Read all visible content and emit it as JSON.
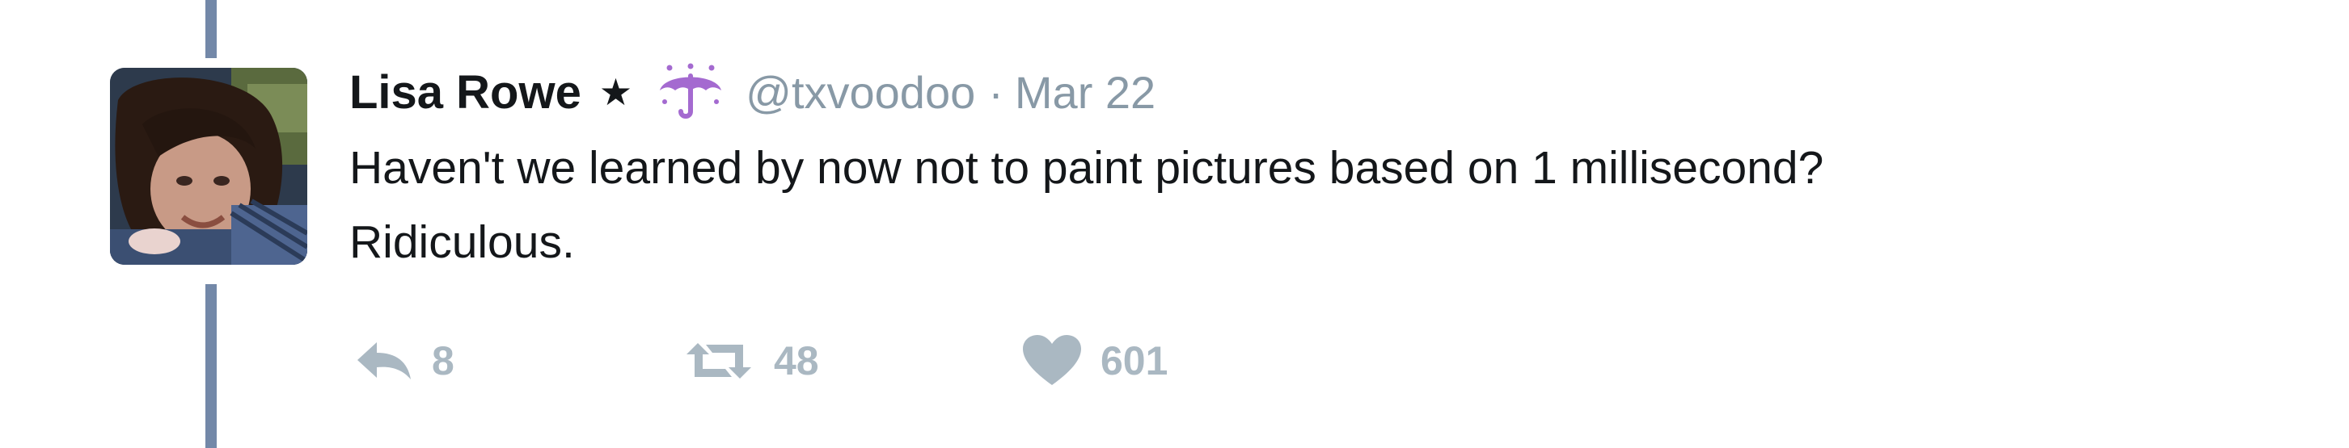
{
  "tweet": {
    "author": {
      "name": "Lisa Rowe",
      "handle": "@txvoodoo"
    },
    "separator": "·",
    "date": "Mar 22",
    "text_lines": [
      "Haven't we learned by now not to paint pictures based on 1 millisecond?",
      "Ridiculous."
    ],
    "icons": {
      "name_badge": "star-icon",
      "emoji": "umbrella-with-rain-icon",
      "reply": "reply-icon",
      "retweet": "retweet-icon",
      "like": "heart-icon"
    },
    "actions": {
      "reply_count": "8",
      "retweet_count": "48",
      "like_count": "601"
    }
  },
  "colors": {
    "text": "#14171a",
    "muted": "#8899a6",
    "action": "#aab8c2",
    "thread_line": "#7388a8",
    "emoji": "#a46ad0"
  }
}
